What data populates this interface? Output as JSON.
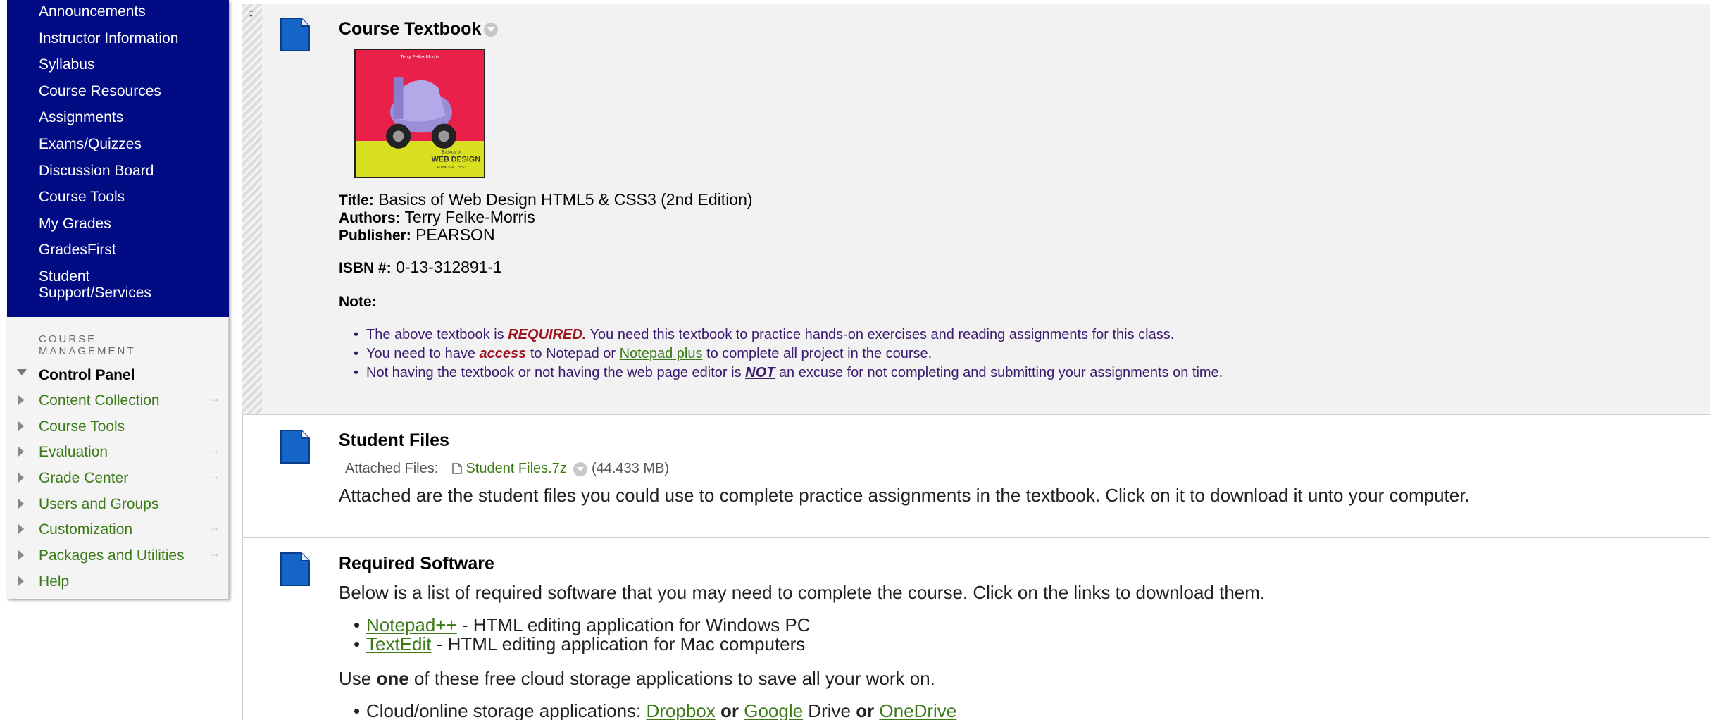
{
  "sidebar": {
    "menu_items": [
      "Announcements",
      "Instructor Information",
      "Syllabus",
      "Course Resources",
      "Assignments",
      "Exams/Quizzes",
      "Discussion Board",
      "Course Tools",
      "My Grades",
      "GradesFirst",
      "Student",
      "Support/Services"
    ],
    "course_management_line1": "COURSE",
    "course_management_line2": "MANAGEMENT",
    "control_panel": "Control Panel",
    "control_panel_items": [
      "Content Collection",
      "Course Tools",
      "Evaluation",
      "Grade Center",
      "Users and Groups",
      "Customization",
      "Packages and Utilities",
      "Help"
    ],
    "arrow_glyph": "→"
  },
  "textbook": {
    "title": "Course Textbook",
    "cover": {
      "top_text": "Terry Felke-Morris",
      "small_text": "Basics of",
      "big_text": "WEB DESIGN",
      "sub_text": "HTML5 & CSS3",
      "colors": {
        "top": "#e8204a",
        "bottom": "#d9e021",
        "scooter": "#9b8ed6"
      }
    },
    "title_label": "Title:",
    "title_value": "Basics of Web Design HTML5 & CSS3 (2nd Edition)",
    "authors_label": "Authors:",
    "authors_value": "Terry Felke-Morris",
    "publisher_label": "Publisher:",
    "publisher_value": "PEARSON",
    "isbn_label": "ISBN #:",
    "isbn_value": "0-13-312891-1",
    "note_label": "Note:",
    "notes": {
      "n1_a": "The above textbook is ",
      "n1_req": "REQUIRED.",
      "n1_b": " You need this textbook to practice hands-on exercises and reading assignments for this class.",
      "n2_a": "You need to have ",
      "n2_access": "access",
      "n2_b": " to Notepad or ",
      "n2_link": "Notepad plus",
      "n2_c": " to complete all project in the course.",
      "n3_a": "Not having the textbook or not having the web page editor is ",
      "n3_not": "NOT",
      "n3_b": " an excuse for not completing and submitting your assignments on time."
    }
  },
  "student_files": {
    "title": "Student Files",
    "attached_label": "Attached Files:",
    "file_name": "Student Files.7z",
    "file_size": "(44.433 MB)",
    "description": "Attached are the student files you could use to complete practice assignments in the textbook.  Click on it to download it unto your computer."
  },
  "required_software": {
    "title": "Required Software",
    "intro": "Below is a list of required software that you may need to complete the course. Click on the links to download them.",
    "sw1_link": "Notepad++",
    "sw1_text": " - HTML editing application for Windows PC",
    "sw2_link": "TextEdit",
    "sw2_text": " - HTML editing application for Mac computers",
    "use_a": "Use ",
    "use_one": "one",
    "use_b": " of these free cloud storage applications to save all your work on.",
    "cloud_a": "Cloud/online storage applications:  ",
    "cloud_l1": "Dropbox",
    "or": " or ",
    "cloud_l2": "Google",
    "cloud_b": " Drive ",
    "cloud_l3": "OneDrive"
  },
  "icons": {
    "item": "content-item-icon",
    "file": "file-icon",
    "handle": "drag-handle-icon"
  },
  "colors": {
    "menu_bg": "#000b84",
    "link_green": "#3b7a17",
    "note_purple": "#3a1a6e",
    "required_red": "#a0121e"
  }
}
